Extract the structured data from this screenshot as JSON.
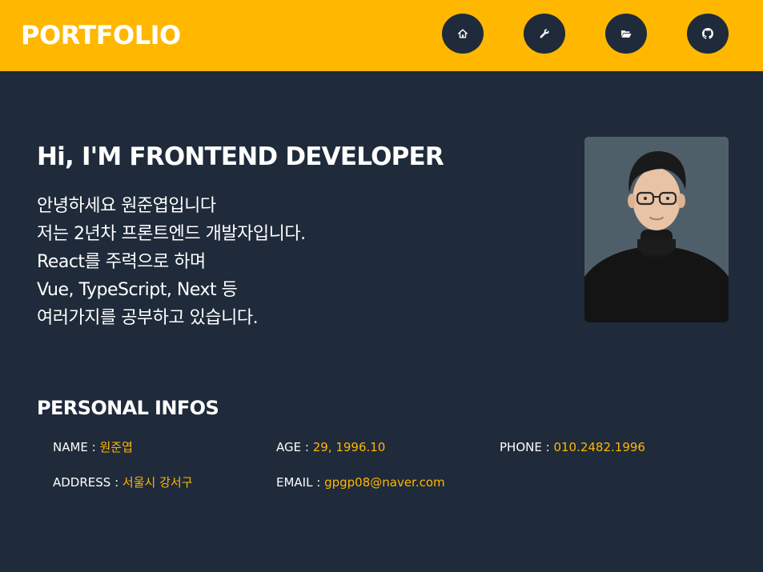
{
  "header": {
    "logo": "PORTFOLIO",
    "nav": [
      {
        "icon": "home-icon"
      },
      {
        "icon": "wrench-icon"
      },
      {
        "icon": "folder-open-icon"
      },
      {
        "icon": "github-icon"
      }
    ]
  },
  "hero": {
    "title": "Hi, I'M FRONTEND DEVELOPER",
    "intro": [
      "안녕하세요 원준엽입니다",
      "저는 2년차 프론트엔드 개발자입니다.",
      "React를 주력으로 하며",
      "Vue, TypeScript, Next 등",
      "여러가지를 공부하고 있습니다."
    ]
  },
  "personal": {
    "title": "PERSONAL INFOS",
    "name": {
      "label": "NAME :",
      "value": "원준엽"
    },
    "age": {
      "label": "AGE :",
      "value": "29, 1996.10"
    },
    "phone": {
      "label": "PHONE :",
      "value": "010.2482.1996"
    },
    "address": {
      "label": "ADDRESS :",
      "value": "서울시 강서구"
    },
    "email": {
      "label": "EMAIL :",
      "value": "gpgp08@naver.com"
    }
  },
  "colors": {
    "accent": "#ffb700",
    "background": "#1f2a3a",
    "text": "#ffffff"
  }
}
